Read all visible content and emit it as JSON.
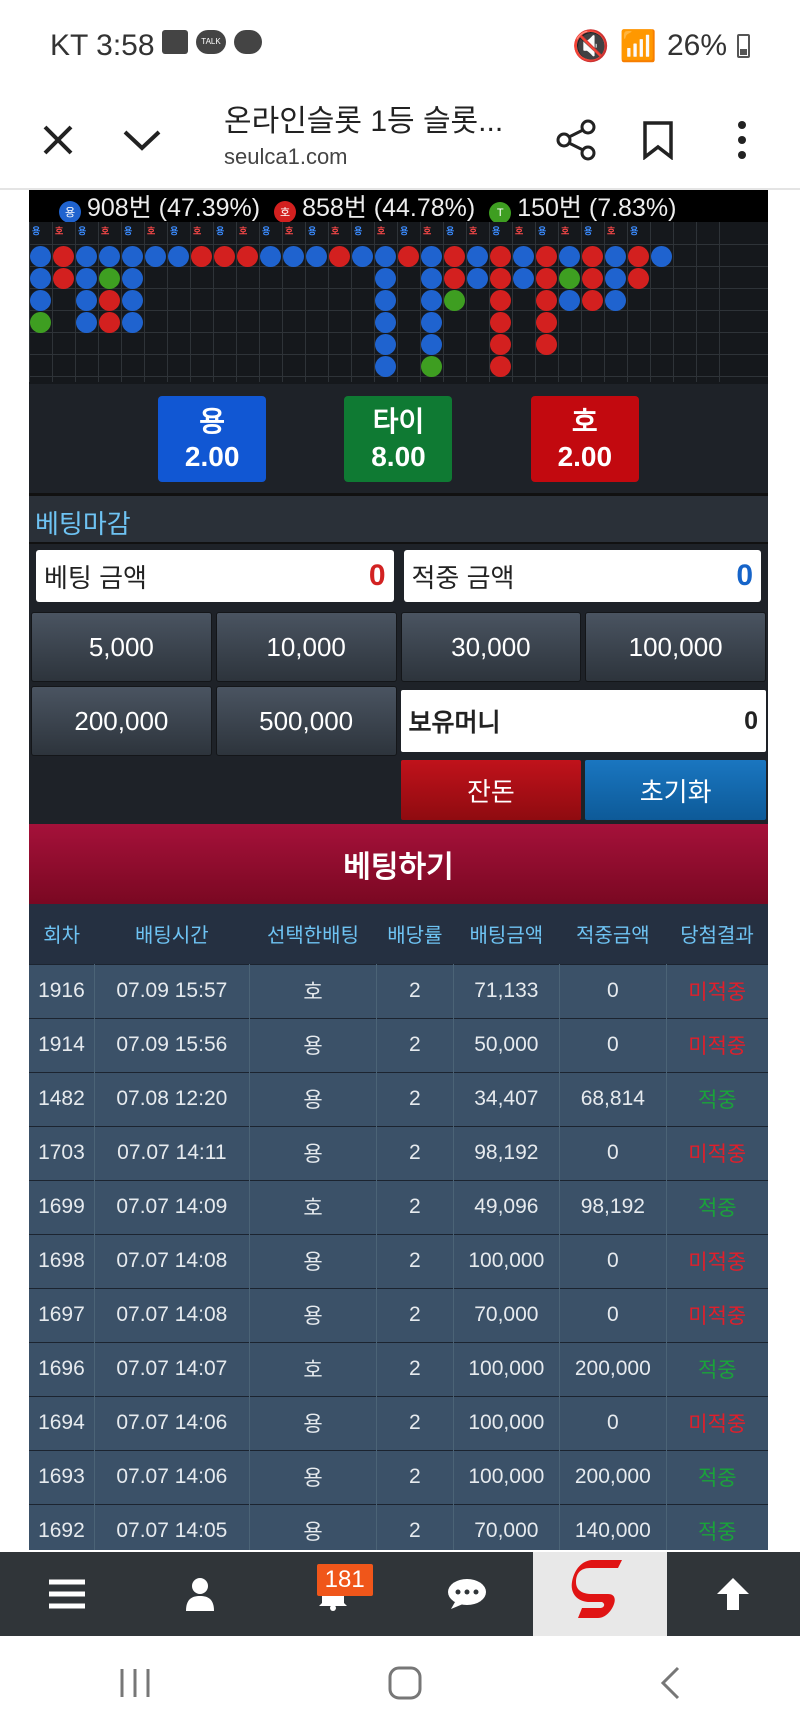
{
  "status_bar": {
    "carrier_time": "KT 3:58",
    "battery": "26%"
  },
  "browser": {
    "title": "온라인슬롯 1등 슬롯...",
    "url": "seulca1.com"
  },
  "stats": [
    {
      "dot": "용",
      "text": "908번 (47.39%)",
      "color": "#1f63cf"
    },
    {
      "dot": "호",
      "text": "858번 (44.78%)",
      "color": "#d3201f"
    },
    {
      "dot": "T",
      "text": "150번 (7.83%)",
      "color": "#3e9e21"
    }
  ],
  "road_header": [
    "용",
    "호",
    "용",
    "호",
    "용",
    "호",
    "용",
    "호",
    "용",
    "호",
    "용",
    "호",
    "용",
    "호",
    "용",
    "호",
    "용",
    "호",
    "용",
    "호",
    "용",
    "호",
    "용",
    "호",
    "용",
    "호",
    "용"
  ],
  "odds": [
    {
      "name": "용",
      "value": "2.00",
      "color": "#1157d3"
    },
    {
      "name": "타이",
      "value": "8.00",
      "color": "#0f7a33"
    },
    {
      "name": "호",
      "value": "2.00",
      "color": "#c2090f"
    }
  ],
  "section_title": "베팅마감",
  "bet_amount": {
    "label": "베팅 금액",
    "value": "0",
    "color": "#d22222"
  },
  "hit_amount": {
    "label": "적중 금액",
    "value": "0",
    "color": "#1664c9"
  },
  "chips": [
    "5,000",
    "10,000",
    "30,000",
    "100,000",
    "200,000",
    "500,000"
  ],
  "holding": {
    "label": "보유머니",
    "value": "0"
  },
  "actions": {
    "change": "잔돈",
    "reset": "초기화"
  },
  "bet_button": "베팅하기",
  "table": {
    "headers": [
      "회차",
      "배팅시간",
      "선택한배팅",
      "배당률",
      "배팅금액",
      "적중금액",
      "당첨결과"
    ],
    "rows": [
      [
        "1916",
        "07.09 15:57",
        "호",
        "2",
        "71,133",
        "0",
        "미적중"
      ],
      [
        "1914",
        "07.09 15:56",
        "용",
        "2",
        "50,000",
        "0",
        "미적중"
      ],
      [
        "1482",
        "07.08 12:20",
        "용",
        "2",
        "34,407",
        "68,814",
        "적중"
      ],
      [
        "1703",
        "07.07 14:11",
        "용",
        "2",
        "98,192",
        "0",
        "미적중"
      ],
      [
        "1699",
        "07.07 14:09",
        "호",
        "2",
        "49,096",
        "98,192",
        "적중"
      ],
      [
        "1698",
        "07.07 14:08",
        "용",
        "2",
        "100,000",
        "0",
        "미적중"
      ],
      [
        "1697",
        "07.07 14:08",
        "용",
        "2",
        "70,000",
        "0",
        "미적중"
      ],
      [
        "1696",
        "07.07 14:07",
        "호",
        "2",
        "100,000",
        "200,000",
        "적중"
      ],
      [
        "1694",
        "07.07 14:06",
        "용",
        "2",
        "100,000",
        "0",
        "미적중"
      ],
      [
        "1693",
        "07.07 14:06",
        "용",
        "2",
        "100,000",
        "200,000",
        "적중"
      ],
      [
        "1692",
        "07.07 14:05",
        "용",
        "2",
        "70,000",
        "140,000",
        "적중"
      ]
    ]
  },
  "nav": {
    "badge": "181"
  }
}
